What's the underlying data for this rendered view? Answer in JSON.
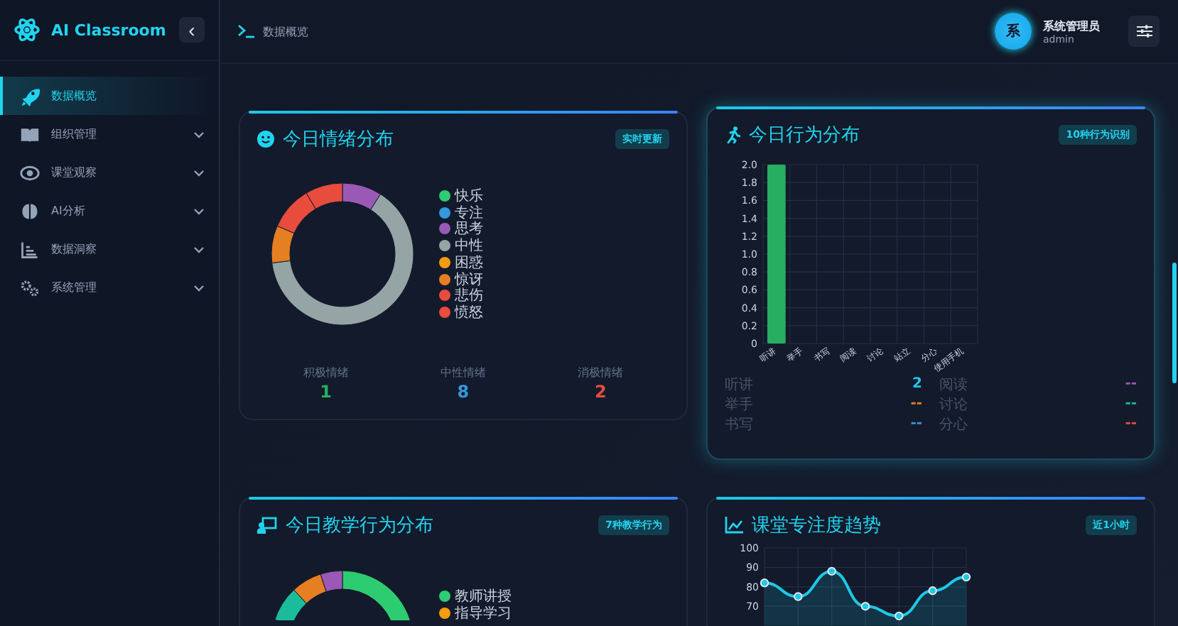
{
  "sidebar": {
    "logo": "AI Classroom",
    "collapse_icon": "‹",
    "items": [
      {
        "label": "数据概览",
        "selected": true,
        "has_submenu": false
      },
      {
        "label": "组织管理",
        "selected": false,
        "has_submenu": true
      },
      {
        "label": "课堂观察",
        "selected": false,
        "has_submenu": true
      },
      {
        "label": "AI分析",
        "selected": false,
        "has_submenu": true
      },
      {
        "label": "数据洞察",
        "selected": false,
        "has_submenu": true
      },
      {
        "label": "系统管理",
        "selected": false,
        "has_submenu": true
      }
    ]
  },
  "header": {
    "breadcrumb": "数据概览",
    "user": {
      "avatar_text": "系",
      "name": "系统管理员",
      "role": "admin"
    }
  },
  "emotion_card": {
    "title": "今日情绪分布",
    "badge": "实时更新",
    "legend": [
      {
        "label": "快乐",
        "color": "#2ecc71"
      },
      {
        "label": "专注",
        "color": "#3498db"
      },
      {
        "label": "思考",
        "color": "#9b59b6"
      },
      {
        "label": "中性",
        "color": "#95a5a6"
      },
      {
        "label": "困惑",
        "color": "#f39c12"
      },
      {
        "label": "惊讶",
        "color": "#e67e22"
      },
      {
        "label": "悲伤",
        "color": "#e74c3c"
      },
      {
        "label": "愤怒",
        "color": "#e74c3c"
      }
    ],
    "summary": [
      {
        "label": "积极情绪",
        "value": "1",
        "color": "#27ae60"
      },
      {
        "label": "中性情绪",
        "value": "8",
        "color": "#3498db"
      },
      {
        "label": "消极情绪",
        "value": "2",
        "color": "#e74c3c"
      }
    ]
  },
  "behavior_card": {
    "title": "今日行为分布",
    "badge": "10种行为识别",
    "chart_data": {
      "type": "bar",
      "categories": [
        "听讲",
        "举手",
        "书写",
        "阅读",
        "讨论",
        "站立",
        "分心",
        "使用手机"
      ],
      "series": [
        {
          "color": "#27ae60",
          "values": [
            2,
            0,
            0,
            0,
            0,
            0,
            0,
            0
          ]
        }
      ],
      "ylim": [
        0,
        2
      ],
      "grid": true,
      "yticks": [
        {
          "value": 0,
          "label": "0"
        },
        {
          "value": 0.2,
          "label": "0.2"
        },
        {
          "value": 0.4,
          "label": "0.4"
        },
        {
          "value": 0.6,
          "label": "0.6"
        },
        {
          "value": 0.8,
          "label": "0.8"
        },
        {
          "value": 1,
          "label": "1.0"
        },
        {
          "value": 1.2,
          "label": "1.2"
        },
        {
          "value": 1.4,
          "label": "1.4"
        },
        {
          "value": 1.6,
          "label": "1.6"
        },
        {
          "value": 1.8,
          "label": "1.8"
        },
        {
          "value": 2,
          "label": "2.0"
        }
      ]
    },
    "stats": [
      {
        "label": "听讲",
        "value": "2",
        "color": "#1ec8e6"
      },
      {
        "label": "阅读",
        "value": "--",
        "color": "#9b59b6"
      },
      {
        "label": "举手",
        "value": "--",
        "color": "#e67e22"
      },
      {
        "label": "讨论",
        "value": "--",
        "color": "#1abc9c"
      },
      {
        "label": "书写",
        "value": "--",
        "color": "#3498db"
      },
      {
        "label": "分心",
        "value": "--",
        "color": "#e74c3c"
      }
    ]
  },
  "teaching_card": {
    "title": "今日教学行为分布",
    "badge": "7种教学行为",
    "legend": [
      {
        "label": "教师讲授",
        "color": "#2ecc71"
      },
      {
        "label": "指导学习",
        "color": "#f39c12"
      }
    ]
  },
  "trend_card": {
    "title": "课堂专注度趋势",
    "badge": "近1小时",
    "chart_data": {
      "type": "area",
      "series": [
        {
          "color": "#1ec8e6",
          "values": [
            82,
            75,
            88,
            70,
            65,
            78,
            85
          ]
        }
      ],
      "ylim": [
        60,
        100
      ],
      "grid": true,
      "yticks": [
        70,
        80,
        90,
        100
      ]
    }
  }
}
